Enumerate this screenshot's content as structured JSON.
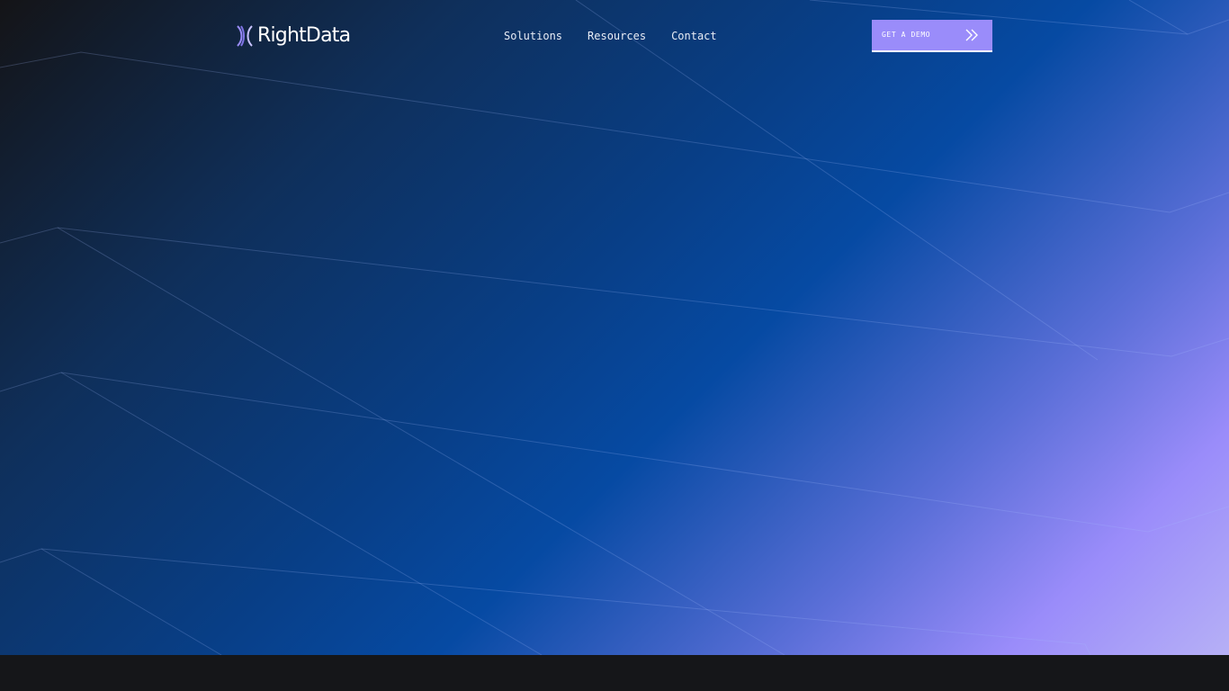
{
  "header": {
    "logo_text": "RightData",
    "nav": [
      {
        "label": "Solutions"
      },
      {
        "label": "Resources"
      },
      {
        "label": "Contact"
      }
    ],
    "cta_label": "GET A DEMO"
  },
  "icons": {
    "logo_mark": "logo-mark-icon",
    "cta_arrow": "double-chevron-right-icon"
  },
  "colors": {
    "accent": "#9a8cfa",
    "gradient_dark": "#141417",
    "gradient_mid": "#064aa3",
    "gradient_light": "#b6b0f6",
    "footer": "#151619"
  }
}
